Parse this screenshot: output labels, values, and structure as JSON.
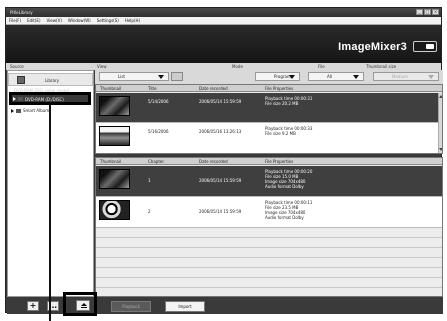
{
  "window": {
    "title": "PIXeLibrary",
    "menu": [
      "File(F)",
      "Edit(E)",
      "View(V)",
      "Window(W)",
      "Settings(S)",
      "Help(H)"
    ]
  },
  "brand": "ImageMixer3",
  "labels": {
    "source": "Source",
    "view": "View",
    "mode": "Mode",
    "file": "File",
    "thumbnail_size": "Thumbnail size"
  },
  "selects": {
    "view": "List",
    "mode": "Program",
    "file": "All",
    "thumbnail_size": "Medium"
  },
  "sidebar": {
    "library": "Library",
    "faded_item": "DVD-RAM DVD video record",
    "dvd_item": "DVD-RAM (D:/DISC)",
    "smart_album": "Smart Album"
  },
  "top_grid": {
    "headers": [
      "Thumbnail",
      "Title",
      "Date recorded",
      "File Properties"
    ],
    "rows": [
      {
        "title": "5/14/2006",
        "date": "2006/05/14 15:59:59",
        "props": [
          "Playback time 00:00:31",
          "File size 20.2 MB"
        ]
      },
      {
        "title": "5/16/2006",
        "date": "2006/05/16 13:26:13",
        "props": [
          "Playback time 00:00:33",
          "File size 9.2 MB"
        ]
      }
    ]
  },
  "bottom_grid": {
    "headers": [
      "Thumbnail",
      "Chapter",
      "Date recorded",
      "File Properties"
    ],
    "rows": [
      {
        "chapter": "1",
        "date": "2006/05/14 15:59:59",
        "props": [
          "Playback time 00:00:20",
          "File size 15.0 MB",
          "Image size 704x480",
          "Audio format Dolby"
        ]
      },
      {
        "chapter": "2",
        "date": "2006/05/14 15:59:59",
        "props": [
          "Playback time 00:00:11",
          "File size 23.5 MB",
          "Image size 704x480",
          "Audio format Dolby"
        ]
      }
    ]
  },
  "buttons": {
    "add": "+",
    "playback": "Playback",
    "import": "Import"
  }
}
